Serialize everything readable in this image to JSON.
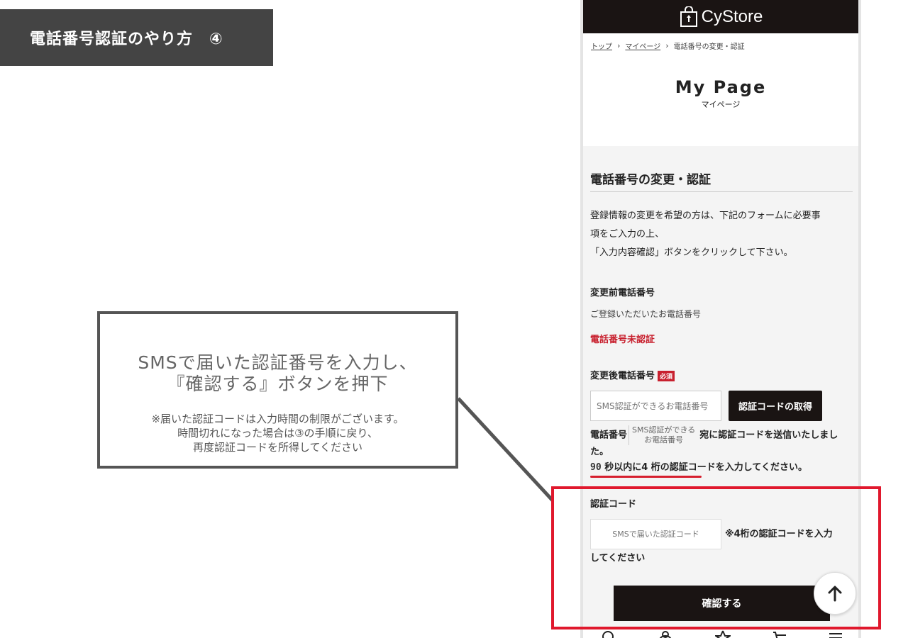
{
  "step_banner": {
    "label": "電話番号認証のやり方　④"
  },
  "callout": {
    "title_line1": "SMSで届いた認証番号を入力し、",
    "title_line2": "『確認する』ボタンを押下",
    "note_line1": "※届いた認証コードは入力時間の制限がございます。",
    "note_line2": "時間切れになった場合は③の手順に戻り、",
    "note_line3": "再度認証コードを所得してください"
  },
  "app": {
    "brand": "CyStore",
    "breadcrumb": {
      "top": "トップ",
      "sep": "›",
      "mypage": "マイページ",
      "current": "電話番号の変更・認証"
    },
    "page_title": "My Page",
    "page_subtitle": "マイページ",
    "section_title": "電話番号の変更・認証",
    "intro_line1": "登録情報の変更を希望の方は、下記のフォームに必要事",
    "intro_line2": "項をご入力の上、",
    "intro_line3": "「入力内容確認」ボタンをクリックして下さい。",
    "before_label": "変更前電話番号",
    "before_value": "ご登録いただいたお電話番号",
    "before_status": "電話番号未認証",
    "after_label": "変更後電話番号",
    "required_badge": "必須",
    "phone_placeholder": "SMS認証ができるお電話番号",
    "get_code_button": "認証コードの取得",
    "sent_prefix": "電話番号",
    "sent_number_line1": "SMS認証ができる",
    "sent_number_line2": "お電話番号",
    "sent_suffix": "宛に認証コードを送信いたしました。",
    "timer_seconds": "90",
    "timer_text": "秒以内に4 桁の認証コードを入力してください。",
    "code_label": "認証コード",
    "code_placeholder": "SMSで届いた認証コード",
    "code_hint": "※4桁の認証コードを入力",
    "code_hint_cont": "してください",
    "confirm_button": "確認する"
  },
  "colors": {
    "accent_red": "#e0182d",
    "header_dark": "#1a1413",
    "banner_gray": "#444444"
  }
}
